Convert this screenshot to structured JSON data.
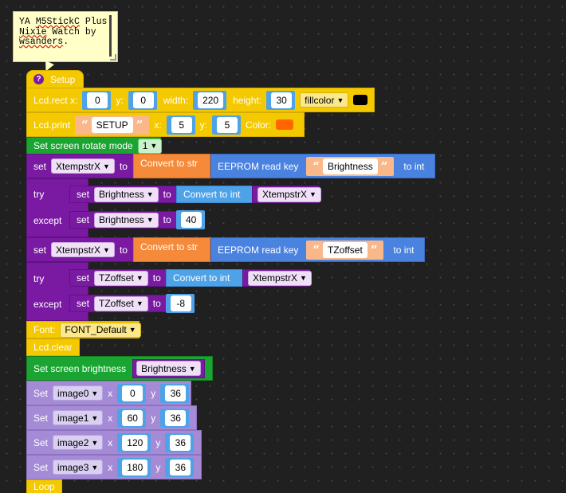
{
  "comment": {
    "line1_a": "YA ",
    "line1_u": "M5StickC",
    "line1_b": " Plus",
    "line2_u": "Nixie",
    "line2_b": " Watch by",
    "line3_u": "wsanders",
    "line3_b": "."
  },
  "setup": {
    "label": "Setup",
    "help_icon": "?"
  },
  "lcd_rect": {
    "label": "Lcd.rect x:",
    "x": "0",
    "y_label": "y:",
    "y": "0",
    "w_label": "width:",
    "w": "220",
    "h_label": "height:",
    "h": "30",
    "mode": "fillcolor",
    "color": "#000000"
  },
  "lcd_print": {
    "label": "Lcd.print",
    "text": "SETUP",
    "x_label": "x:",
    "x": "5",
    "y_label": "y:",
    "y": "5",
    "color_label": "Color:",
    "color": "#ff6600"
  },
  "rotate": {
    "label": "Set screen rotate mode",
    "value": "1"
  },
  "set1": {
    "set": "set",
    "var": "XtempstrX",
    "to": "to",
    "convert": "Convert to str",
    "eeprom": "EEPROM read key",
    "key": "Brightness",
    "to_int": "to int"
  },
  "try1": {
    "try": "try",
    "set": "set",
    "var": "Brightness",
    "to": "to",
    "convert": "Convert to int",
    "src": "XtempstrX"
  },
  "except1": {
    "except": "except",
    "set": "set",
    "var": "Brightness",
    "to": "to",
    "value": "40"
  },
  "set2": {
    "set": "set",
    "var": "XtempstrX",
    "to": "to",
    "convert": "Convert to str",
    "eeprom": "EEPROM read key",
    "key": "TZoffset",
    "to_int": "to int"
  },
  "try2": {
    "try": "try",
    "set": "set",
    "var": "TZoffset",
    "to": "to",
    "convert": "Convert to int",
    "src": "XtempstrX"
  },
  "except2": {
    "except": "except",
    "set": "set",
    "var": "TZoffset",
    "to": "to",
    "value": "-8"
  },
  "font": {
    "label": "Font:",
    "value": "FONT_Default"
  },
  "lcd_clear": {
    "label": "Lcd.clear"
  },
  "brightness": {
    "label": "Set screen brightness",
    "var": "Brightness"
  },
  "images": [
    {
      "set": "Set",
      "name": "image0",
      "x_label": "x",
      "x": "0",
      "y_label": "y",
      "y": "36"
    },
    {
      "set": "Set",
      "name": "image1",
      "x_label": "x",
      "x": "60",
      "y_label": "y",
      "y": "36"
    },
    {
      "set": "Set",
      "name": "image2",
      "x_label": "x",
      "x": "120",
      "y_label": "y",
      "y": "36"
    },
    {
      "set": "Set",
      "name": "image3",
      "x_label": "x",
      "x": "180",
      "y_label": "y",
      "y": "36"
    }
  ],
  "loop": {
    "label": "Loop"
  }
}
